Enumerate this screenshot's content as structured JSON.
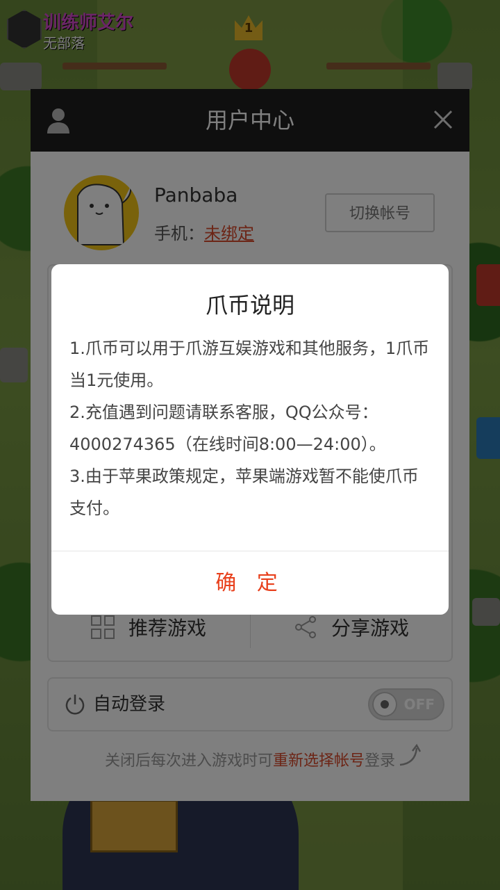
{
  "game": {
    "player_name": "训练师艾尔",
    "clan": "无部落",
    "crown_level": "1"
  },
  "user_center": {
    "title": "用户中心",
    "username": "Panbaba",
    "phone_label": "手机：",
    "phone_status": "未绑定",
    "switch_account_label": "切换帐号",
    "menu": [
      {
        "label": "推荐游戏",
        "icon": "grid-icon"
      },
      {
        "label": "分享游戏",
        "icon": "share-icon"
      }
    ],
    "auto_login_label": "自动登录",
    "auto_login_toggle": "OFF",
    "hint_prefix": "关闭后每次进入游戏时可",
    "hint_link": "重新选择帐号",
    "hint_suffix": "登录"
  },
  "dialog": {
    "title": "爪币说明",
    "lines": [
      "1.爪币可以用于爪游互娱游戏和其他服务，1爪币当1元使用。",
      "2.充值遇到问题请联系客服，QQ公众号：4000274365（在线时间8:00—24:00）。",
      "3.由于苹果政策规定，苹果端游戏暂不能使爪币支付。"
    ],
    "confirm_label": "确 定"
  },
  "colors": {
    "accent": "#e8401c",
    "header_bg": "#1e1e1e",
    "link": "#d94a2c"
  }
}
